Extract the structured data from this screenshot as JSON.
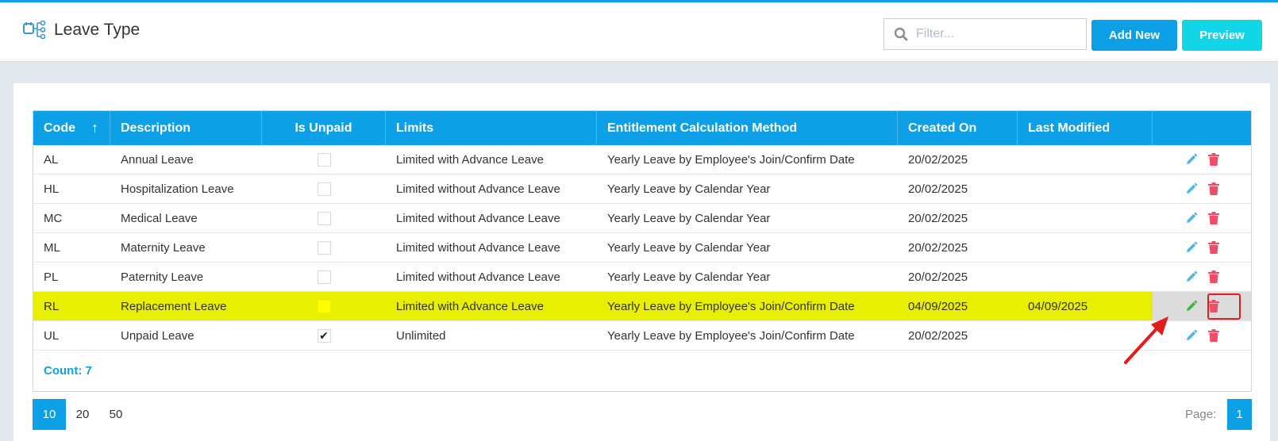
{
  "header": {
    "title": "Leave Type",
    "filter_placeholder": "Filter...",
    "add_new_label": "Add New",
    "preview_label": "Preview"
  },
  "table": {
    "columns": [
      "Code",
      "Description",
      "Is Unpaid",
      "Limits",
      "Entitlement Calculation Method",
      "Created On",
      "Last Modified",
      ""
    ],
    "sort_column": "Code",
    "sort_direction": "ascending",
    "rows": [
      {
        "code": "AL",
        "description": "Annual Leave",
        "is_unpaid": false,
        "limits": "Limited with Advance Leave",
        "method": "Yearly Leave by Employee's Join/Confirm Date",
        "created_on": "20/02/2025",
        "last_modified": ""
      },
      {
        "code": "HL",
        "description": "Hospitalization Leave",
        "is_unpaid": false,
        "limits": "Limited without Advance Leave",
        "method": "Yearly Leave by Calendar Year",
        "created_on": "20/02/2025",
        "last_modified": ""
      },
      {
        "code": "MC",
        "description": "Medical Leave",
        "is_unpaid": false,
        "limits": "Limited without Advance Leave",
        "method": "Yearly Leave by Calendar Year",
        "created_on": "20/02/2025",
        "last_modified": ""
      },
      {
        "code": "ML",
        "description": "Maternity Leave",
        "is_unpaid": false,
        "limits": "Limited without Advance Leave",
        "method": "Yearly Leave by Calendar Year",
        "created_on": "20/02/2025",
        "last_modified": ""
      },
      {
        "code": "PL",
        "description": "Paternity Leave",
        "is_unpaid": false,
        "limits": "Limited without Advance Leave",
        "method": "Yearly Leave by Calendar Year",
        "created_on": "20/02/2025",
        "last_modified": ""
      },
      {
        "code": "RL",
        "description": "Replacement Leave",
        "is_unpaid": false,
        "limits": "Limited with Advance Leave",
        "method": "Yearly Leave by Employee's Join/Confirm Date",
        "created_on": "04/09/2025",
        "last_modified": "04/09/2025",
        "highlighted": true
      },
      {
        "code": "UL",
        "description": "Unpaid Leave",
        "is_unpaid": true,
        "limits": "Unlimited",
        "method": "Yearly Leave by Employee's Join/Confirm Date",
        "created_on": "20/02/2025",
        "last_modified": ""
      }
    ],
    "count_label": "Count: 7"
  },
  "pagination": {
    "page_sizes": [
      "10",
      "20",
      "50"
    ],
    "active_page_size": "10",
    "page_label": "Page:",
    "current_page": "1"
  },
  "icons": {
    "title": "workflow-icon",
    "filter": "search-icon",
    "edit": "pencil-icon",
    "delete": "trash-icon"
  },
  "colors": {
    "accent": "#0ea0e6",
    "preview": "#12d6e8",
    "highlight": "#e8ef00",
    "edit_icon": "#4db8e8",
    "edit_icon_highlighted": "#3db83d",
    "delete_icon": "#ef4d6a",
    "annotation": "#e41b1b"
  }
}
